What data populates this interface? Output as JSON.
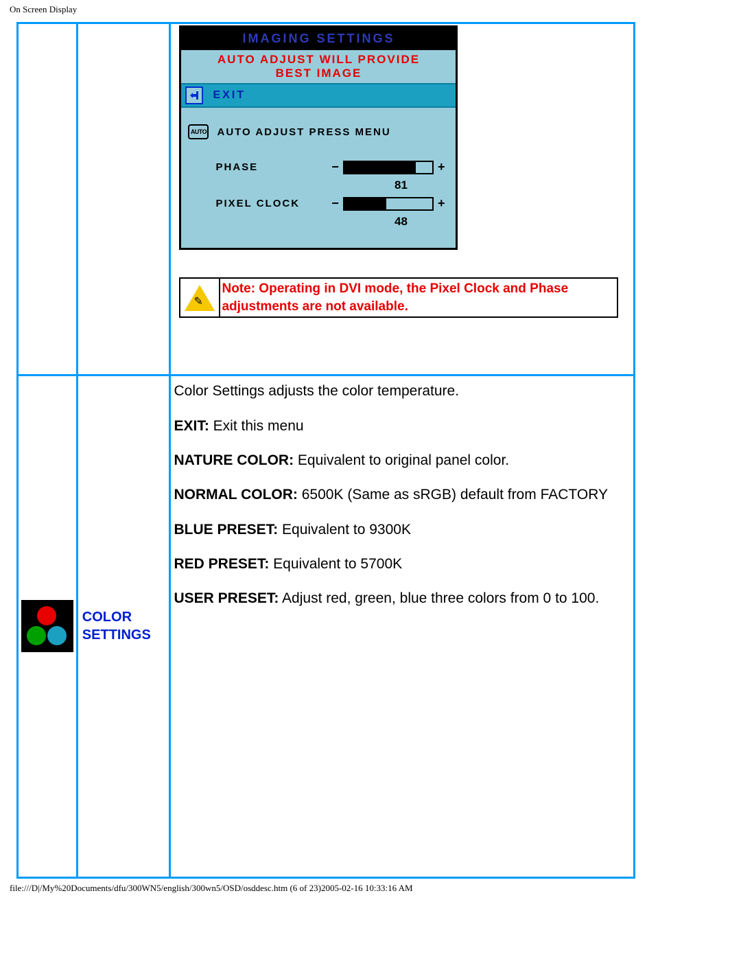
{
  "page_title": "On Screen Display",
  "footer": "file:///D|/My%20Documents/dfu/300WN5/english/300wn5/OSD/osddesc.htm (6 of 23)2005-02-16 10:33:16 AM",
  "osd": {
    "title": "IMAGING SETTINGS",
    "sub1": "AUTO ADJUST WILL PROVIDE",
    "sub2": "BEST IMAGE",
    "exit_label": "EXIT",
    "auto_icon_text": "AUTO",
    "auto_adjust": "AUTO ADJUST PRESS MENU",
    "phase_label": "PHASE",
    "phase_value": "81",
    "phase_fill_pct": 81,
    "pixel_clock_label": "PIXEL CLOCK",
    "pixel_clock_value": "48",
    "pixel_clock_fill_pct": 48,
    "minus": "−",
    "plus": "+"
  },
  "note": "Note: Operating in DVI mode, the Pixel Clock and Phase adjustments are not available.",
  "color_section_label": "COLOR SETTINGS",
  "color_desc": {
    "intro": "Color Settings adjusts the color temperature.",
    "exit_bold": "EXIT:",
    "exit_text": " Exit this menu",
    "nature_bold": "NATURE COLOR:",
    "nature_text": " Equivalent to original panel color.",
    "normal_bold": "NORMAL COLOR:",
    "normal_text": " 6500K (Same as sRGB) default from FACTORY",
    "blue_bold": "BLUE PRESET:",
    "blue_text": " Equivalent to 9300K",
    "red_bold": "RED PRESET:",
    "red_text": " Equivalent to 5700K",
    "user_bold": "USER PRESET:",
    "user_text": " Adjust red, green, blue three colors from 0 to 100."
  }
}
